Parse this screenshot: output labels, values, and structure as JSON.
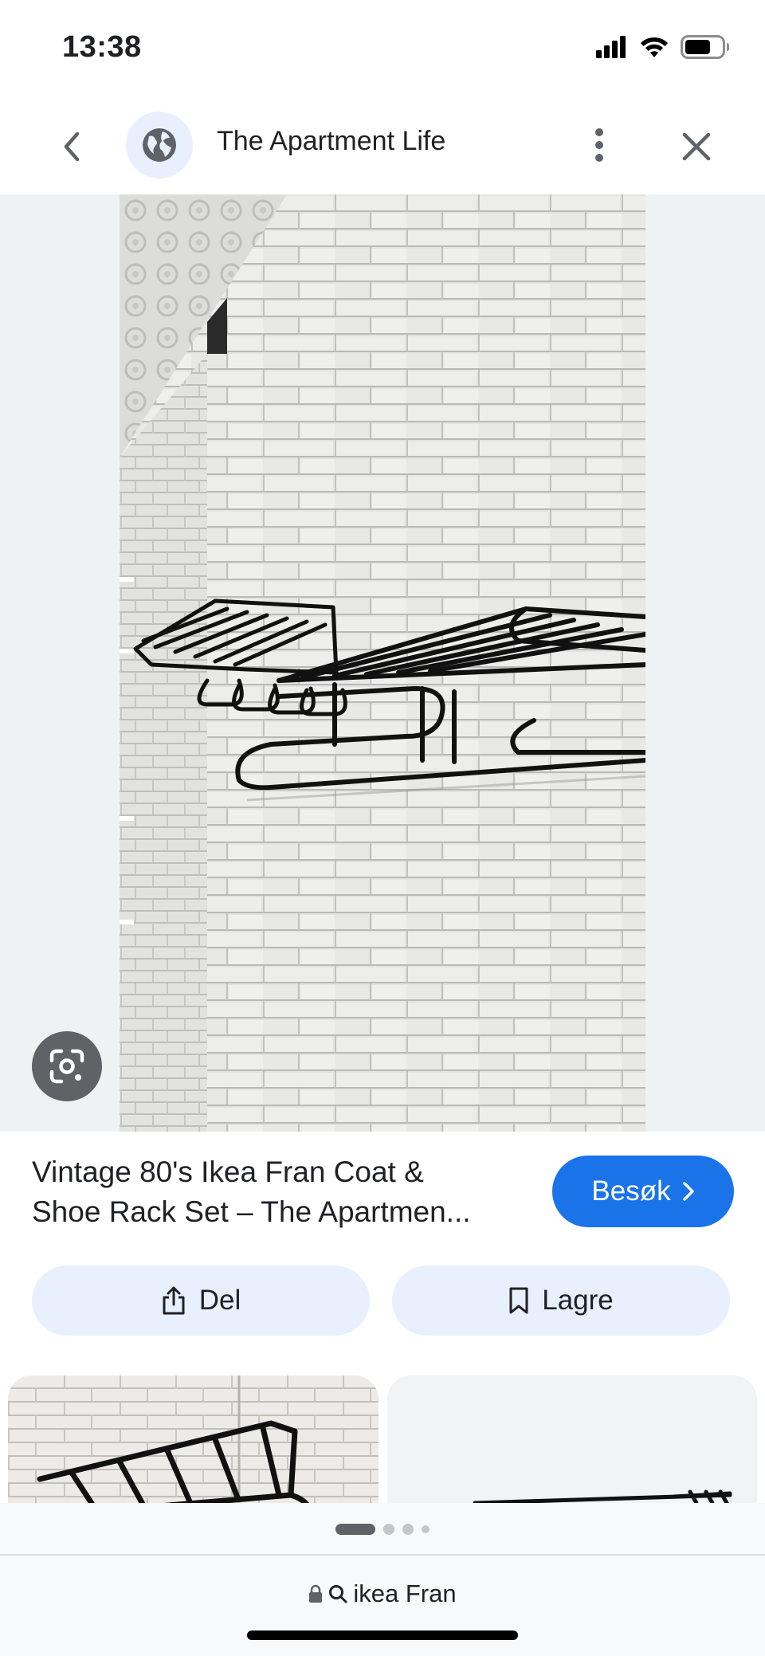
{
  "status_bar": {
    "time": "13:38",
    "battery_level": 0.7
  },
  "header": {
    "site_title": "The Apartment Life",
    "icons": [
      "back-arrow-icon",
      "globe-icon",
      "more-vert-icon",
      "close-icon"
    ]
  },
  "result": {
    "title_line1": "Vintage 80's Ikea Fran Coat &",
    "title_line2": "Shoe Rack Set – The Apartmen...",
    "visit_label": "Besøk"
  },
  "actions": {
    "share_label": "Del",
    "save_label": "Lagre"
  },
  "pager": {
    "total": 4,
    "active_index": 0
  },
  "address_bar": {
    "query": "ikea Fran"
  },
  "colors": {
    "accent": "#1a73e8",
    "chip_bg": "#e8f0fe",
    "viewer_bg": "#eef2f3",
    "lens_button": "#5f6368"
  }
}
